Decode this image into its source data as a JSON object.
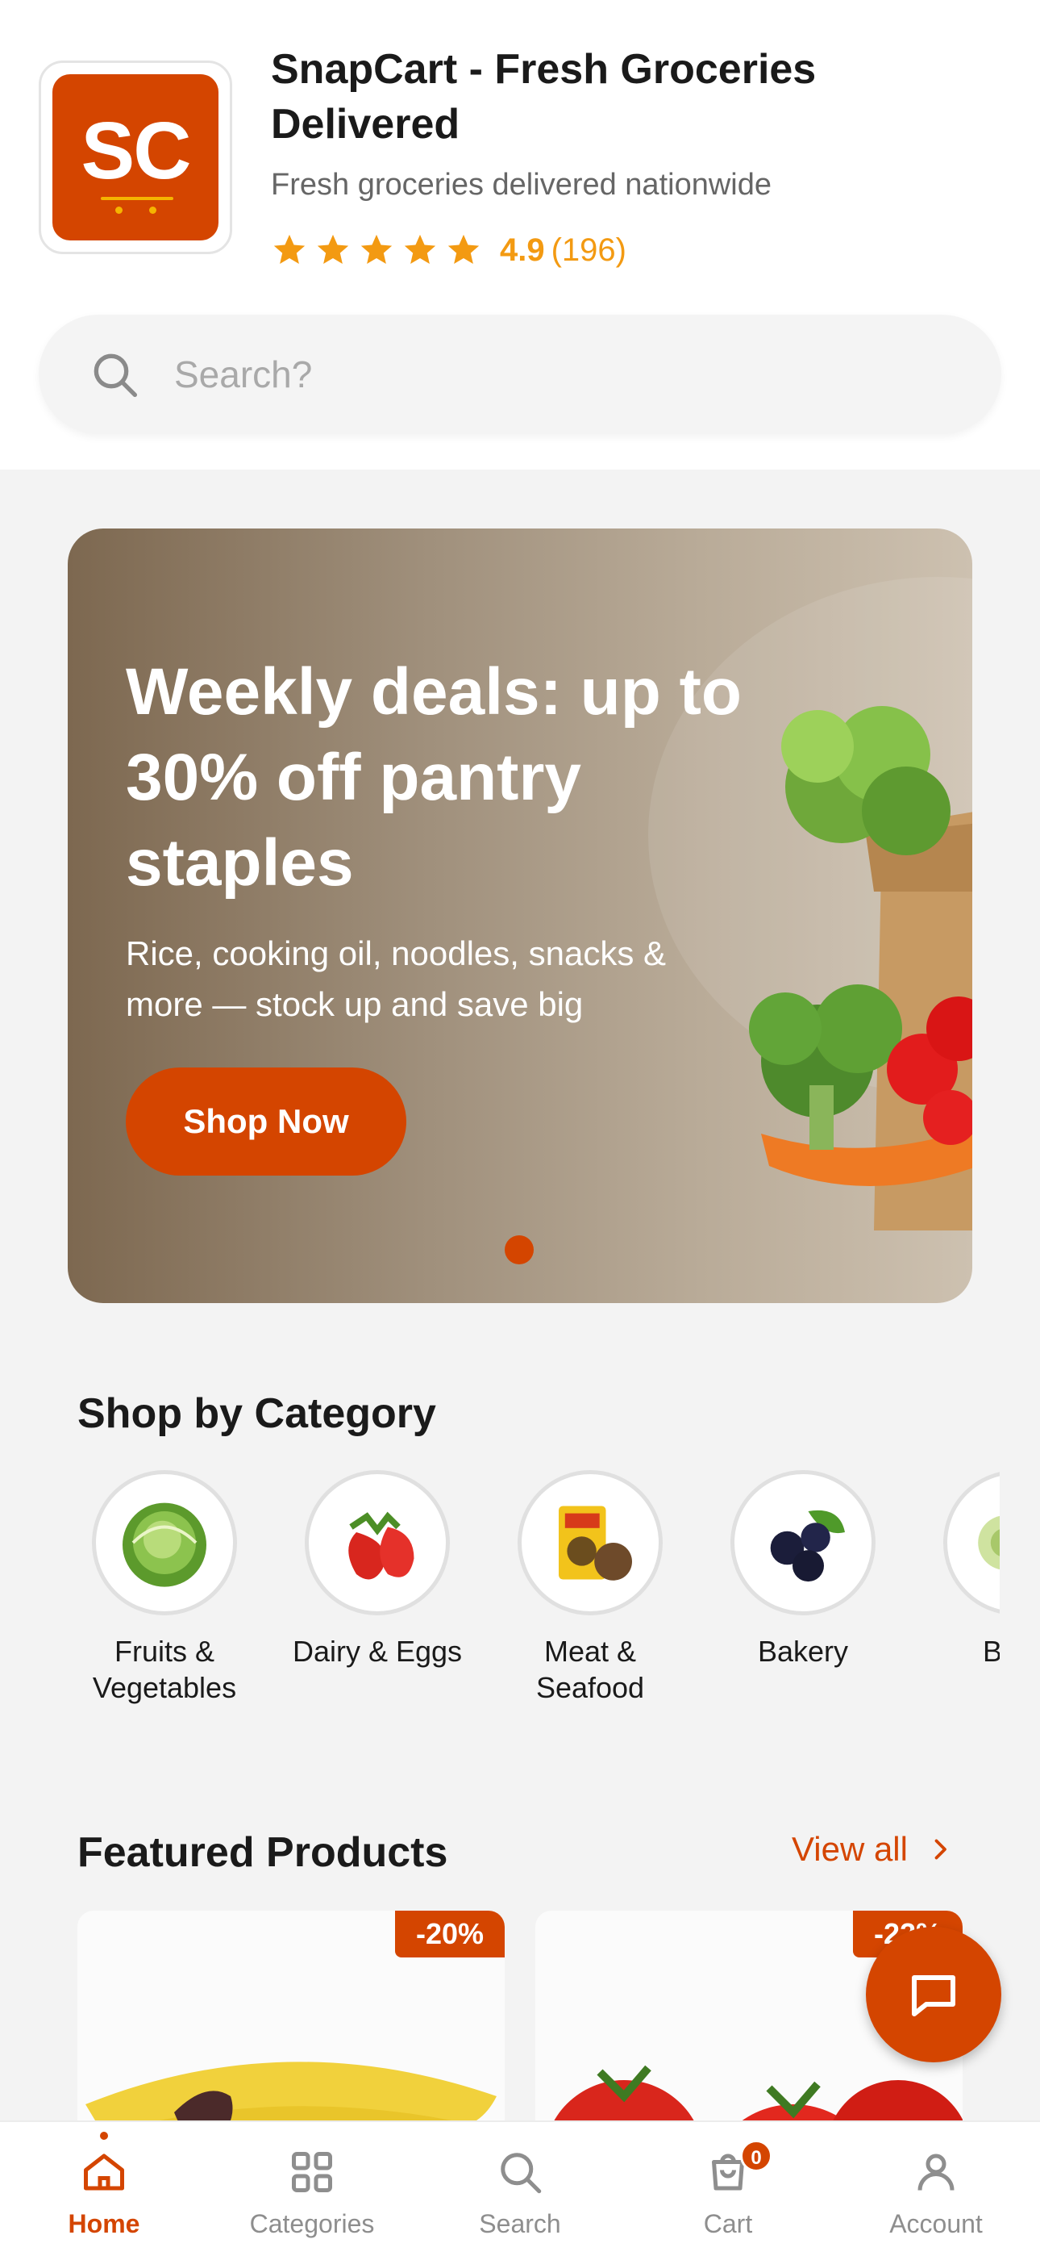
{
  "app": {
    "icon_text": "SC",
    "title": "SnapCart - Fresh Groceries Delivered",
    "subtitle": "Fresh groceries delivered nationwide",
    "rating": "4.9",
    "rating_count": "(196)"
  },
  "search": {
    "placeholder": "Search?"
  },
  "banner": {
    "title": "Weekly deals: up to 30% off pantry staples",
    "subtitle": "Rice, cooking oil, noodles, snacks & more — stock up and save big",
    "cta": "Shop Now"
  },
  "categories": {
    "title": "Shop by Category",
    "items": [
      {
        "label": "Fruits & Vegetables",
        "icon": "cabbage-icon"
      },
      {
        "label": "Dairy & Eggs",
        "icon": "strawberry-icon"
      },
      {
        "label": "Meat & Seafood",
        "icon": "grocery-pack-icon"
      },
      {
        "label": "Bakery",
        "icon": "berries-icon"
      },
      {
        "label": "Beve",
        "icon": "flower-icon"
      }
    ]
  },
  "featured": {
    "title": "Featured Products",
    "view_all": "View all",
    "products": [
      {
        "discount": "-20%",
        "image": "banana-icon"
      },
      {
        "discount": "-22%",
        "image": "tomato-icon"
      }
    ]
  },
  "nav": {
    "items": [
      {
        "label": "Home",
        "icon": "home-icon",
        "active": true
      },
      {
        "label": "Categories",
        "icon": "grid-icon",
        "active": false
      },
      {
        "label": "Search",
        "icon": "search-icon",
        "active": false
      },
      {
        "label": "Cart",
        "icon": "cart-icon",
        "badge": "0",
        "active": false
      },
      {
        "label": "Account",
        "icon": "account-icon",
        "active": false
      }
    ]
  },
  "colors": {
    "accent": "#d44500",
    "star": "#f39a12"
  }
}
